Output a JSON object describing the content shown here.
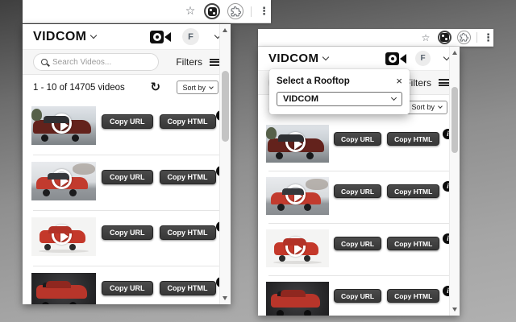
{
  "browser_chrome": {
    "icons": [
      "bookmark-star-icon",
      "vidcom-extension-icon",
      "extensions-puzzle-icon",
      "menu-kebab-icon"
    ]
  },
  "popup": {
    "brand": "VIDCOM",
    "avatar_initial": "F",
    "search_placeholder": "Search Videos...",
    "filters_label": "Filters",
    "results_text": "1 - 10 of 14705 videos",
    "sort_by_label": "Sort by",
    "copy_url_label": "Copy URL",
    "copy_html_label": "Copy HTML",
    "videos": [
      {
        "thumbnail": "maroon-suv-driveway",
        "has_play_button": true
      },
      {
        "thumbnail": "red-hatchback-street",
        "has_play_button": true
      },
      {
        "thumbnail": "red-jeep-studio-white",
        "has_play_button": true
      },
      {
        "thumbnail": "red-jeep-studio-dark",
        "has_play_button": false
      }
    ]
  },
  "rooftop_modal": {
    "title": "Select a Rooftop",
    "close_label": "×",
    "selected_option": "VIDCOM"
  },
  "colors": {
    "button_bg": "#3c3c3c",
    "button_text": "#ffffff",
    "car_red": "#c23b2e",
    "panel_bg": "#ffffff",
    "search_row_bg": "#f6f6f6"
  }
}
